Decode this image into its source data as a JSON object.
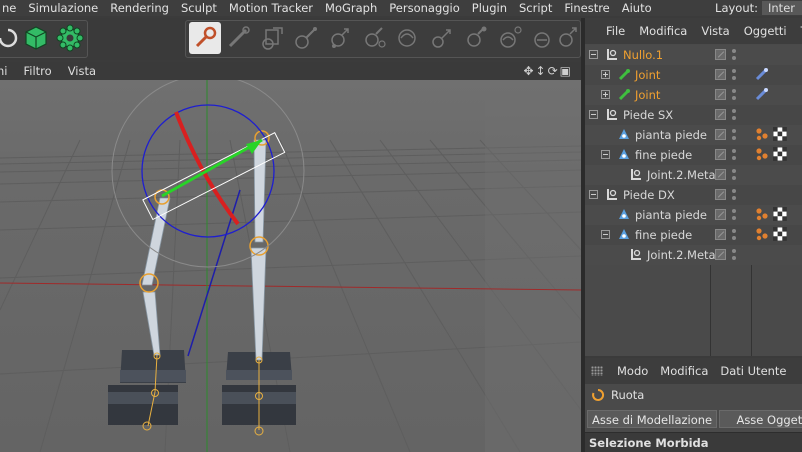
{
  "menubar": {
    "items": [
      "ne",
      "Simulazione",
      "Rendering",
      "Sculpt",
      "Motion Tracker",
      "MoGraph",
      "Personaggio",
      "Plugin",
      "Script",
      "Finestre",
      "Aiuto"
    ],
    "layout_label": "Layout:",
    "layout_value": "Inter"
  },
  "toolbar": {
    "tools": [
      "undo-icon",
      "cube-icon",
      "gear-icon",
      "joint-tool-icon",
      "bone-icon",
      "ik-icon",
      "ik-chain-icon",
      "pose-icon",
      "weight-icon",
      "paint-icon",
      "joint-align-icon",
      "mirror-icon",
      "link-icon",
      "bind-icon",
      "restore-icon"
    ]
  },
  "viewport": {
    "menu": [
      "ni",
      "Filtro",
      "Vista"
    ],
    "nav_icons": [
      "move-icon",
      "zoom-icon",
      "rotate-icon",
      "maximize-icon"
    ]
  },
  "object_manager": {
    "menu": [
      "File",
      "Modifica",
      "Vista",
      "Oggetti",
      "Ta"
    ],
    "rows": [
      {
        "name": "Nullo.1",
        "type": "null",
        "indent": 0,
        "expander": "minus",
        "highlight": true,
        "tags": []
      },
      {
        "name": "Joint",
        "type": "joint",
        "indent": 1,
        "expander": "plus",
        "highlight": true,
        "tags": [
          "ik-tag"
        ]
      },
      {
        "name": "Joint",
        "type": "joint",
        "indent": 1,
        "expander": "plus",
        "highlight": true,
        "tags": [
          "ik-tag"
        ]
      },
      {
        "name": "Piede SX",
        "type": "null",
        "indent": 0,
        "expander": "minus",
        "highlight": false,
        "tags": []
      },
      {
        "name": "pianta piede",
        "type": "effector",
        "indent": 1,
        "expander": "",
        "highlight": false,
        "tags": [
          "constraint-tag",
          "checker-tag"
        ]
      },
      {
        "name": "fine piede",
        "type": "effector",
        "indent": 1,
        "expander": "minus",
        "highlight": false,
        "tags": [
          "constraint-tag",
          "checker-tag"
        ]
      },
      {
        "name": "Joint.2.Meta",
        "type": "null",
        "indent": 2,
        "expander": "",
        "highlight": false,
        "tags": []
      },
      {
        "name": "Piede DX",
        "type": "null",
        "indent": 0,
        "expander": "minus",
        "highlight": false,
        "tags": []
      },
      {
        "name": "pianta piede",
        "type": "effector",
        "indent": 1,
        "expander": "",
        "highlight": false,
        "tags": [
          "constraint-tag",
          "checker-tag"
        ]
      },
      {
        "name": "fine piede",
        "type": "effector",
        "indent": 1,
        "expander": "minus",
        "highlight": false,
        "tags": [
          "constraint-tag",
          "checker-tag"
        ]
      },
      {
        "name": "Joint.2.Meta",
        "type": "null",
        "indent": 2,
        "expander": "",
        "highlight": false,
        "tags": []
      }
    ]
  },
  "attribute_manager": {
    "menu": [
      "Modo",
      "Modifica",
      "Dati Utente"
    ],
    "tool_name": "Ruota",
    "tabs": [
      "Asse di Modellazione",
      "Asse Oggetto"
    ],
    "section": "Selezione Morbida"
  },
  "colors": {
    "highlight_text": "#f0a030",
    "viewport_bg": "#6b6b6b",
    "axis_green": "#22cc22",
    "axis_red": "#dd2222",
    "gizmo_blue": "#2222cc"
  }
}
